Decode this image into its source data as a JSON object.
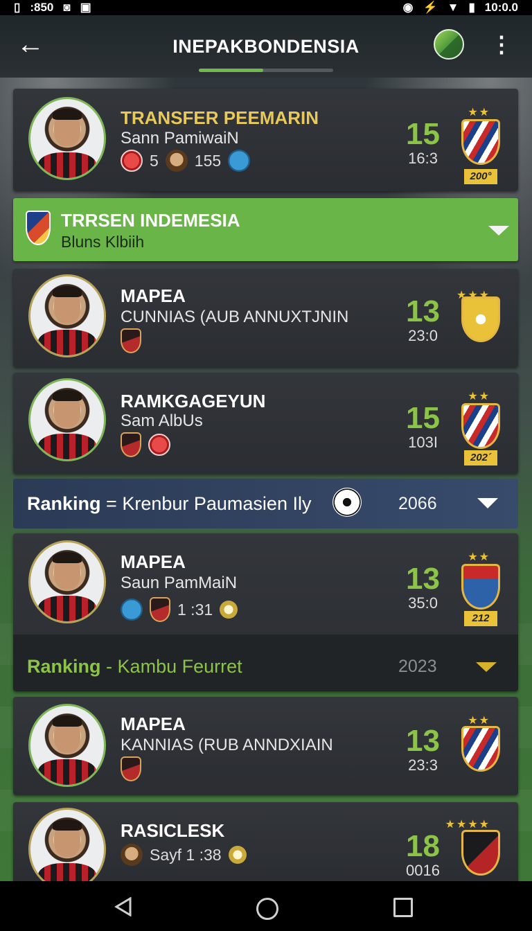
{
  "status": {
    "left_time": ":850",
    "right_time": "10:0.0"
  },
  "appbar": {
    "title": "INEPAKBONDENSIA",
    "back_icon": "arrow-left-icon",
    "progress_percent": 48
  },
  "cards": [
    {
      "name": "TRANSFER PEEMARIN",
      "club": "Sann PamiwaiN",
      "stat_a": "5",
      "stat_b": "155",
      "rating": "15",
      "sub": "16:3",
      "badge": "200°"
    },
    {
      "name": "MAPEA",
      "club": "CUNNIAS (AUB ANNUXTJNIN",
      "rating": "13",
      "sub": "23:0"
    },
    {
      "name": "RAMKGAGEYUN",
      "club": "Sam AlbUs",
      "rating": "15",
      "sub": "103I",
      "badge": "202´"
    },
    {
      "name": "MAPEA",
      "club": "Saun PamMaiN",
      "stat": "1 :31",
      "rating": "13",
      "sub": "35:0",
      "badge": "212"
    },
    {
      "name": "MAPEA",
      "club": "KANNIAS (RUB ANNDXIAIN",
      "rating": "13",
      "sub": "23:3"
    },
    {
      "name": "RASICLESK",
      "stat": "Sayf 1 :38",
      "rating": "18",
      "sub": "0016"
    }
  ],
  "section_green": {
    "title": "TRRSEN INDEMESIA",
    "subtitle": "Bluns Klbiih"
  },
  "section_blue": {
    "label": "Ranking",
    "sep": "=",
    "text": "Krenbur Paumasien Ily",
    "year": "2066"
  },
  "section_dark": {
    "label": "Ranking",
    "sep": "-",
    "text": "Kambu Feurret",
    "year": "2023"
  },
  "colors": {
    "accent_green": "#6ab547",
    "rating_green": "#8cc447",
    "gold": "#e9c23a"
  }
}
